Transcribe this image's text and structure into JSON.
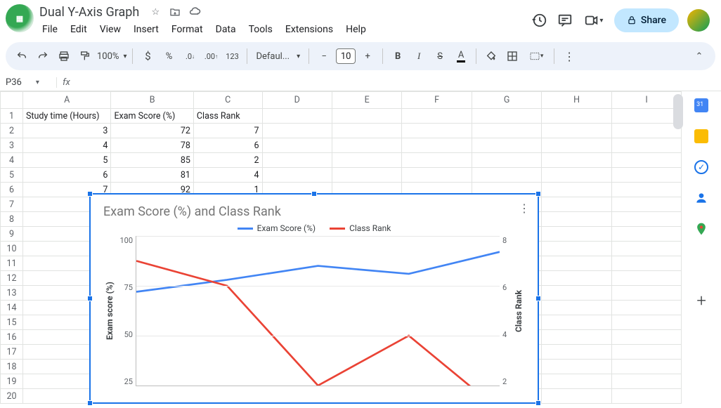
{
  "doc_title": "Dual Y-Axis Graph",
  "menus": [
    "File",
    "Edit",
    "View",
    "Insert",
    "Format",
    "Data",
    "Tools",
    "Extensions",
    "Help"
  ],
  "share_label": "Share",
  "zoom": "100%",
  "font_name": "Defaul...",
  "font_size": "10",
  "namebox": "P36",
  "columns": [
    "A",
    "B",
    "C",
    "D",
    "E",
    "F",
    "G",
    "H",
    "I"
  ],
  "headers": [
    "Study time (Hours)",
    "Exam Score (%)",
    "Class Rank"
  ],
  "rows": [
    {
      "a": "3",
      "b": "72",
      "c": "7"
    },
    {
      "a": "4",
      "b": "78",
      "c": "6"
    },
    {
      "a": "5",
      "b": "85",
      "c": "2"
    },
    {
      "a": "6",
      "b": "81",
      "c": "4"
    },
    {
      "a": "7",
      "b": "92",
      "c": "1"
    }
  ],
  "chart_title": "Exam Score (%) and Class Rank",
  "legend_series1": "Exam Score (%)",
  "legend_series2": "Class Rank",
  "yaxis_left_label": "Exam score (%)",
  "yaxis_right_label": "Class Rank",
  "yticks_left": [
    "100",
    "75",
    "50",
    "25"
  ],
  "yticks_right": [
    "8",
    "6",
    "4",
    "2"
  ],
  "chart_data": {
    "type": "line",
    "title": "Exam Score (%) and Class Rank",
    "x": [
      3,
      4,
      5,
      6,
      7
    ],
    "xlabel": "Study time (Hours)",
    "series": [
      {
        "name": "Exam Score (%)",
        "axis": "left",
        "values": [
          72,
          78,
          85,
          81,
          92
        ],
        "color": "#4285f4"
      },
      {
        "name": "Class Rank",
        "axis": "right",
        "values": [
          7,
          6,
          2,
          4,
          1
        ],
        "color": "#ea4335"
      }
    ],
    "y_left": {
      "label": "Exam score (%)",
      "ticks": [
        25,
        50,
        75,
        100
      ],
      "range": [
        0,
        100
      ]
    },
    "y_right": {
      "label": "Class Rank",
      "ticks": [
        2,
        4,
        6,
        8
      ],
      "range": [
        0,
        8
      ]
    }
  }
}
